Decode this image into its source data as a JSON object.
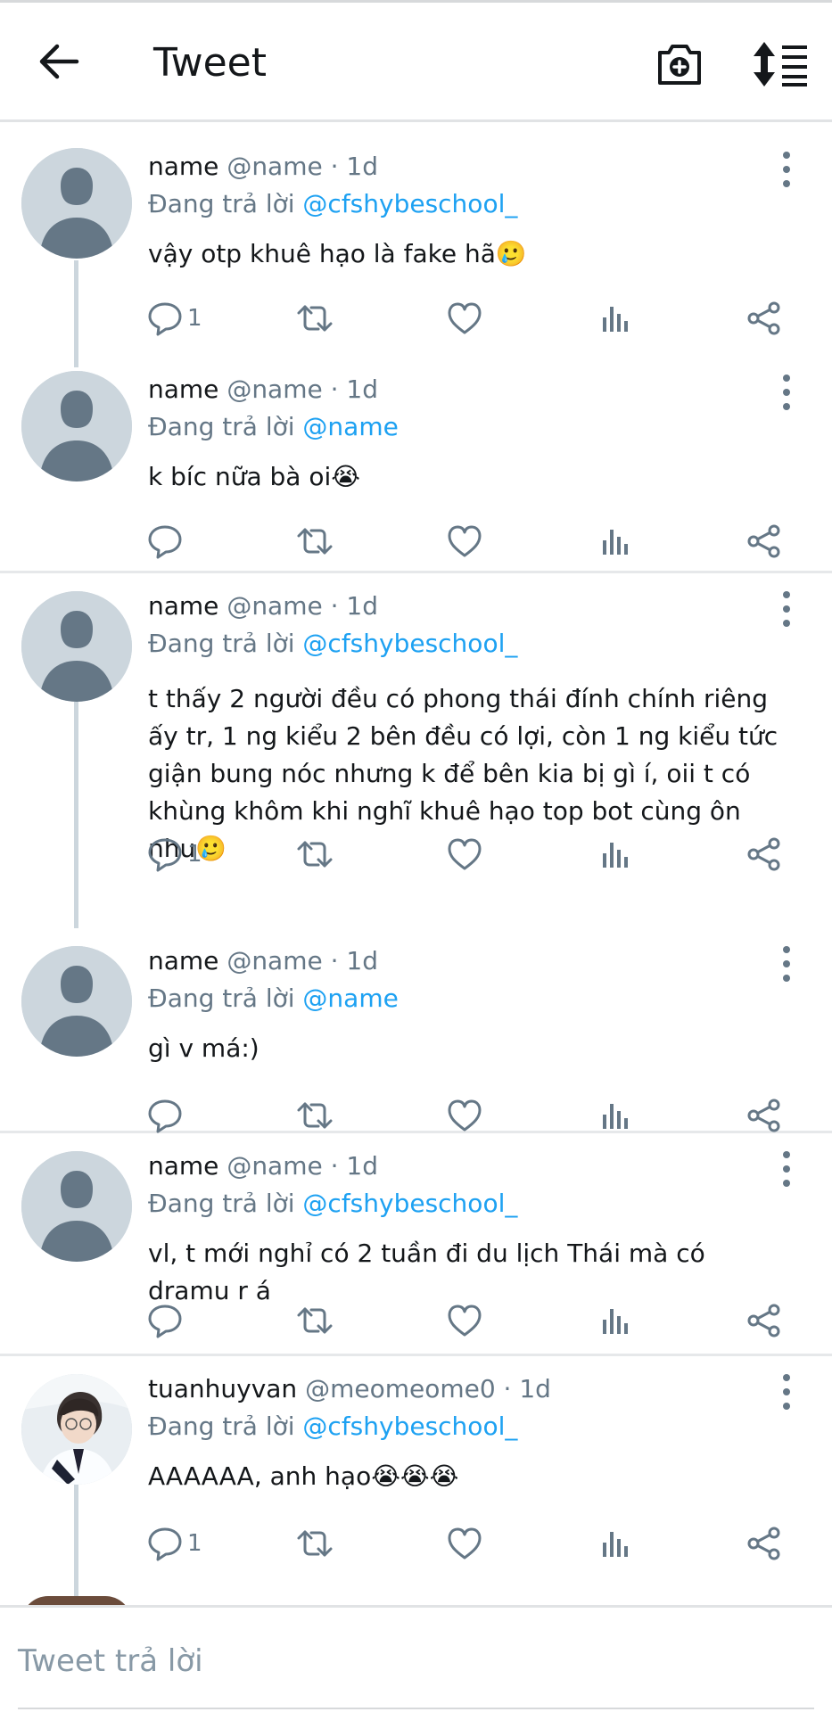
{
  "header": {
    "title": "Tweet",
    "back_icon": "arrow-left-icon",
    "camera_icon": "camera-plus-icon",
    "sort_icon": "sort-icon"
  },
  "colors": {
    "mention": "#1da1f2",
    "secondary": "#657786",
    "primary_text": "#14171a",
    "avatar_placeholder": "#ccd6dd"
  },
  "tweets": [
    {
      "name": "name",
      "handle": "@name · 1d",
      "reply_prefix": "Đang trả lời ",
      "reply_to": "@cfshybeschool_",
      "text": "vậy otp khuê hạo là fake hã🥲",
      "reply_count": "1"
    },
    {
      "name": "name",
      "handle": "@name · 1d",
      "reply_prefix": "Đang trả lời ",
      "reply_to": "@name",
      "text": "k bíc nữa bà oi😭",
      "reply_count": ""
    },
    {
      "name": "name",
      "handle": "@name · 1d",
      "reply_prefix": "Đang trả lời ",
      "reply_to": "@cfshybeschool_",
      "text": "t thấy 2 người đều có phong thái đính chính riêng ấy tr, 1 ng kiểu 2 bên đều có lợi, còn 1 ng kiểu tức giận bung nóc nhưng k để bên kia bị gì í, oii t có khùng khôm khi nghĩ khuê hạo top bot cùng ôn nhu🥲",
      "reply_count": "1"
    },
    {
      "name": "name",
      "handle": "@name · 1d",
      "reply_prefix": "Đang trả lời ",
      "reply_to": "@name",
      "text": "gì v má:)",
      "reply_count": ""
    },
    {
      "name": "name",
      "handle": "@name · 1d",
      "reply_prefix": "Đang trả lời ",
      "reply_to": "@cfshybeschool_",
      "text": "vl, t mới nghỉ có 2 tuần đi du lịch Thái mà có dramu r á",
      "reply_count": ""
    },
    {
      "name": "tuanhuyvan",
      "handle": "@meomeome0 · 1d",
      "reply_prefix": "Đang trả lời ",
      "reply_to": "@cfshybeschool_",
      "text": "AAAAAA, anh hạo😭😭😭",
      "reply_count": "1"
    }
  ],
  "compose": {
    "placeholder": "Tweet trả lời"
  }
}
